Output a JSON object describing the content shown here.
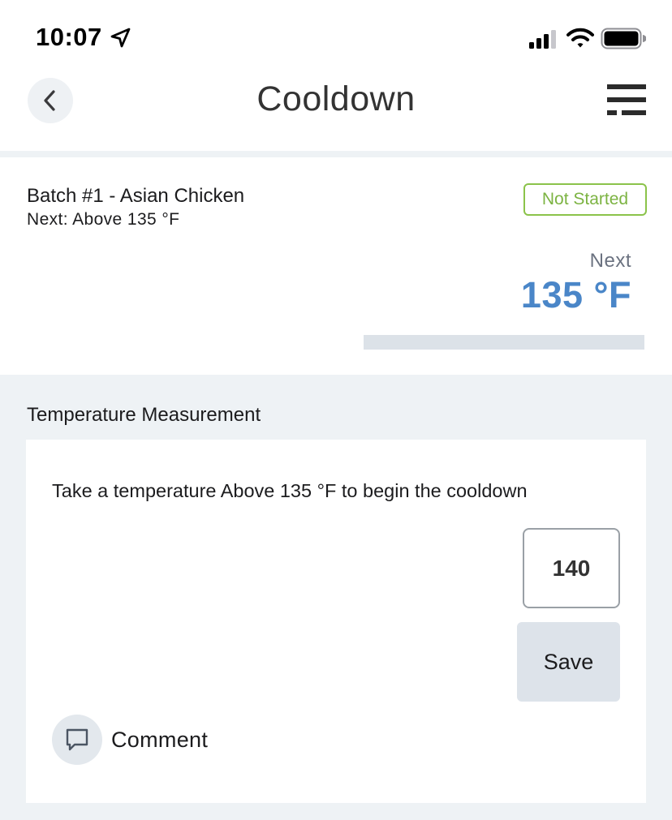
{
  "status_bar": {
    "time": "10:07"
  },
  "header": {
    "title": "Cooldown"
  },
  "batch": {
    "name": "Batch #1 - Asian Chicken",
    "next_line": "Next: Above 135 °F",
    "status": "Not Started",
    "next_label": "Next",
    "next_value": "135 °F",
    "progress_percent": 0
  },
  "measurement": {
    "section_title": "Temperature Measurement",
    "instruction": "Take a temperature Above 135 °F to begin the cooldown",
    "input_value": "140",
    "save_label": "Save",
    "comment_label": "Comment"
  },
  "colors": {
    "accent": "#4a86c8",
    "status_green": "#7cb342"
  },
  "icons": {
    "location": "location-arrow-icon",
    "signal": "cellular-signal-icon",
    "wifi": "wifi-icon",
    "battery": "battery-icon",
    "back": "chevron-left-icon",
    "menu": "menu-icon",
    "comment": "comment-bubble-icon"
  }
}
